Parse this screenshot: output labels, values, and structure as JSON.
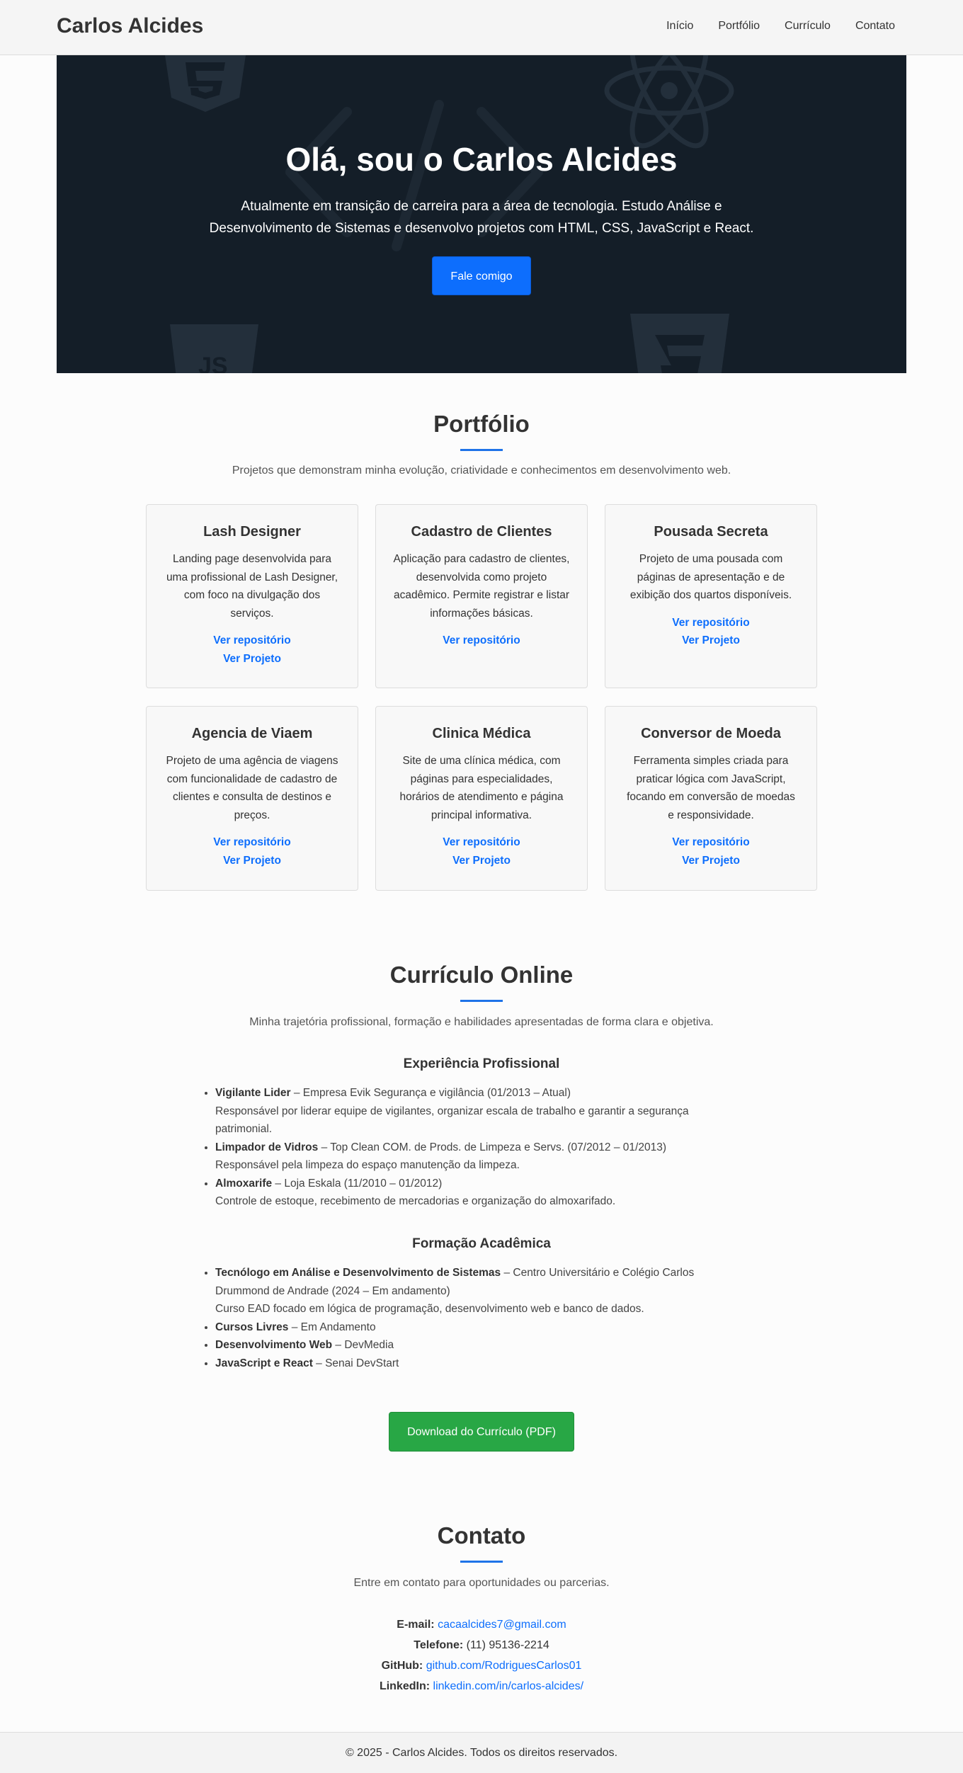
{
  "header": {
    "brand": "Carlos Alcides",
    "nav": [
      "Início",
      "Portfólio",
      "Currículo",
      "Contato"
    ]
  },
  "hero": {
    "title": "Olá, sou o Carlos Alcides",
    "text_line1": "Atualmente em transição de carreira para a área de tecnologia. Estudo Análise e",
    "text_line2": "Desenvolvimento de Sistemas e desenvolvo projetos com HTML, CSS, JavaScript e React.",
    "button": "Fale comigo",
    "background_icons": [
      "html5-icon",
      "react-icon",
      "code-icon",
      "js-icon",
      "html5-icon"
    ],
    "bg_color": "#141e28",
    "accent": "#0d6efd"
  },
  "portfolio": {
    "title": "Portfólio",
    "subtitle": "Projetos que demonstram minha evolução, criatividade e conhecimentos em desenvolvimento web.",
    "cards": [
      {
        "title": "Lash Designer",
        "desc": "Landing page desenvolvida para uma profissional de Lash Designer, com foco na divulgação dos serviços.",
        "repo": "Ver repositório",
        "project": "Ver Projeto"
      },
      {
        "title": "Cadastro de Clientes",
        "desc": "Aplicação para cadastro de clientes, desenvolvida como projeto acadêmico. Permite registrar e listar informações básicas.",
        "repo": "Ver repositório",
        "project": ""
      },
      {
        "title": "Pousada Secreta",
        "desc": "Projeto de uma pousada com páginas de apresentação e de exibição dos quartos disponíveis.",
        "repo": "Ver repositório",
        "project": "Ver Projeto"
      },
      {
        "title": "Agencia de Viaem",
        "desc": "Projeto de uma agência de viagens com funcionalidade de cadastro de clientes e consulta de destinos e preços.",
        "repo": "Ver repositório",
        "project": "Ver Projeto"
      },
      {
        "title": "Clinica Médica",
        "desc": "Site de uma clínica médica, com páginas para especialidades, horários de atendimento e página principal informativa.",
        "repo": "Ver repositório",
        "project": "Ver Projeto"
      },
      {
        "title": "Conversor de Moeda",
        "desc": "Ferramenta simples criada para praticar lógica com JavaScript, focando em conversão de moedas e responsividade.",
        "repo": "Ver repositório",
        "project": "Ver Projeto"
      }
    ]
  },
  "resume": {
    "title": "Currículo Online",
    "subtitle": "Minha trajetória profissional, formação e habilidades apresentadas de forma clara e objetiva.",
    "experience_title": "Experiência Profissional",
    "experience": [
      {
        "role": "Vigilante Lider",
        "rest": " – Empresa Evik Segurança e vigilância (01/2013 – Atual)",
        "desc": "Responsável por liderar equipe de vigilantes, organizar escala de trabalho e garantir a segurança patrimonial."
      },
      {
        "role": "Limpador de Vidros",
        "rest": " – Top Clean COM. de Prods. de Limpeza e Servs. (07/2012 – 01/2013)",
        "desc": "Responsável pela limpeza do espaço manutenção da limpeza."
      },
      {
        "role": "Almoxarife",
        "rest": " – Loja Eskala (11/2010 – 01/2012)",
        "desc": "Controle de estoque, recebimento de mercadorias e organização do almoxarifado."
      }
    ],
    "education_title": "Formação Acadêmica",
    "education": [
      {
        "name": "Tecnólogo em Análise e Desenvolvimento de Sistemas",
        "rest": " – Centro Universitário e Colégio Carlos Drummond de Andrade (2024 – Em andamento)",
        "desc": "Curso EAD focado em lógica de programação, desenvolvimento web e banco de dados."
      },
      {
        "name": "Cursos Livres",
        "rest": " – Em Andamento",
        "desc": ""
      },
      {
        "name": "Desenvolvimento Web",
        "rest": " – DevMedia",
        "desc": ""
      },
      {
        "name": "JavaScript e React",
        "rest": " – Senai DevStart",
        "desc": ""
      }
    ],
    "download": "Download do Currículo (PDF)"
  },
  "contact": {
    "title": "Contato",
    "subtitle": "Entre em contato para oportunidades ou parcerias.",
    "email_label": "E-mail:",
    "email": "cacaalcides7@gmail.com",
    "phone_label": "Telefone:",
    "phone": "(11) 95136-2214",
    "github_label": "GitHub:",
    "github": "github.com/RodriguesCarlos01",
    "linkedin_label": "LinkedIn:",
    "linkedin": "linkedin.com/in/carlos-alcides/"
  },
  "footer": {
    "text": "© 2025 - Carlos Alcides. Todos os direitos reservados."
  }
}
